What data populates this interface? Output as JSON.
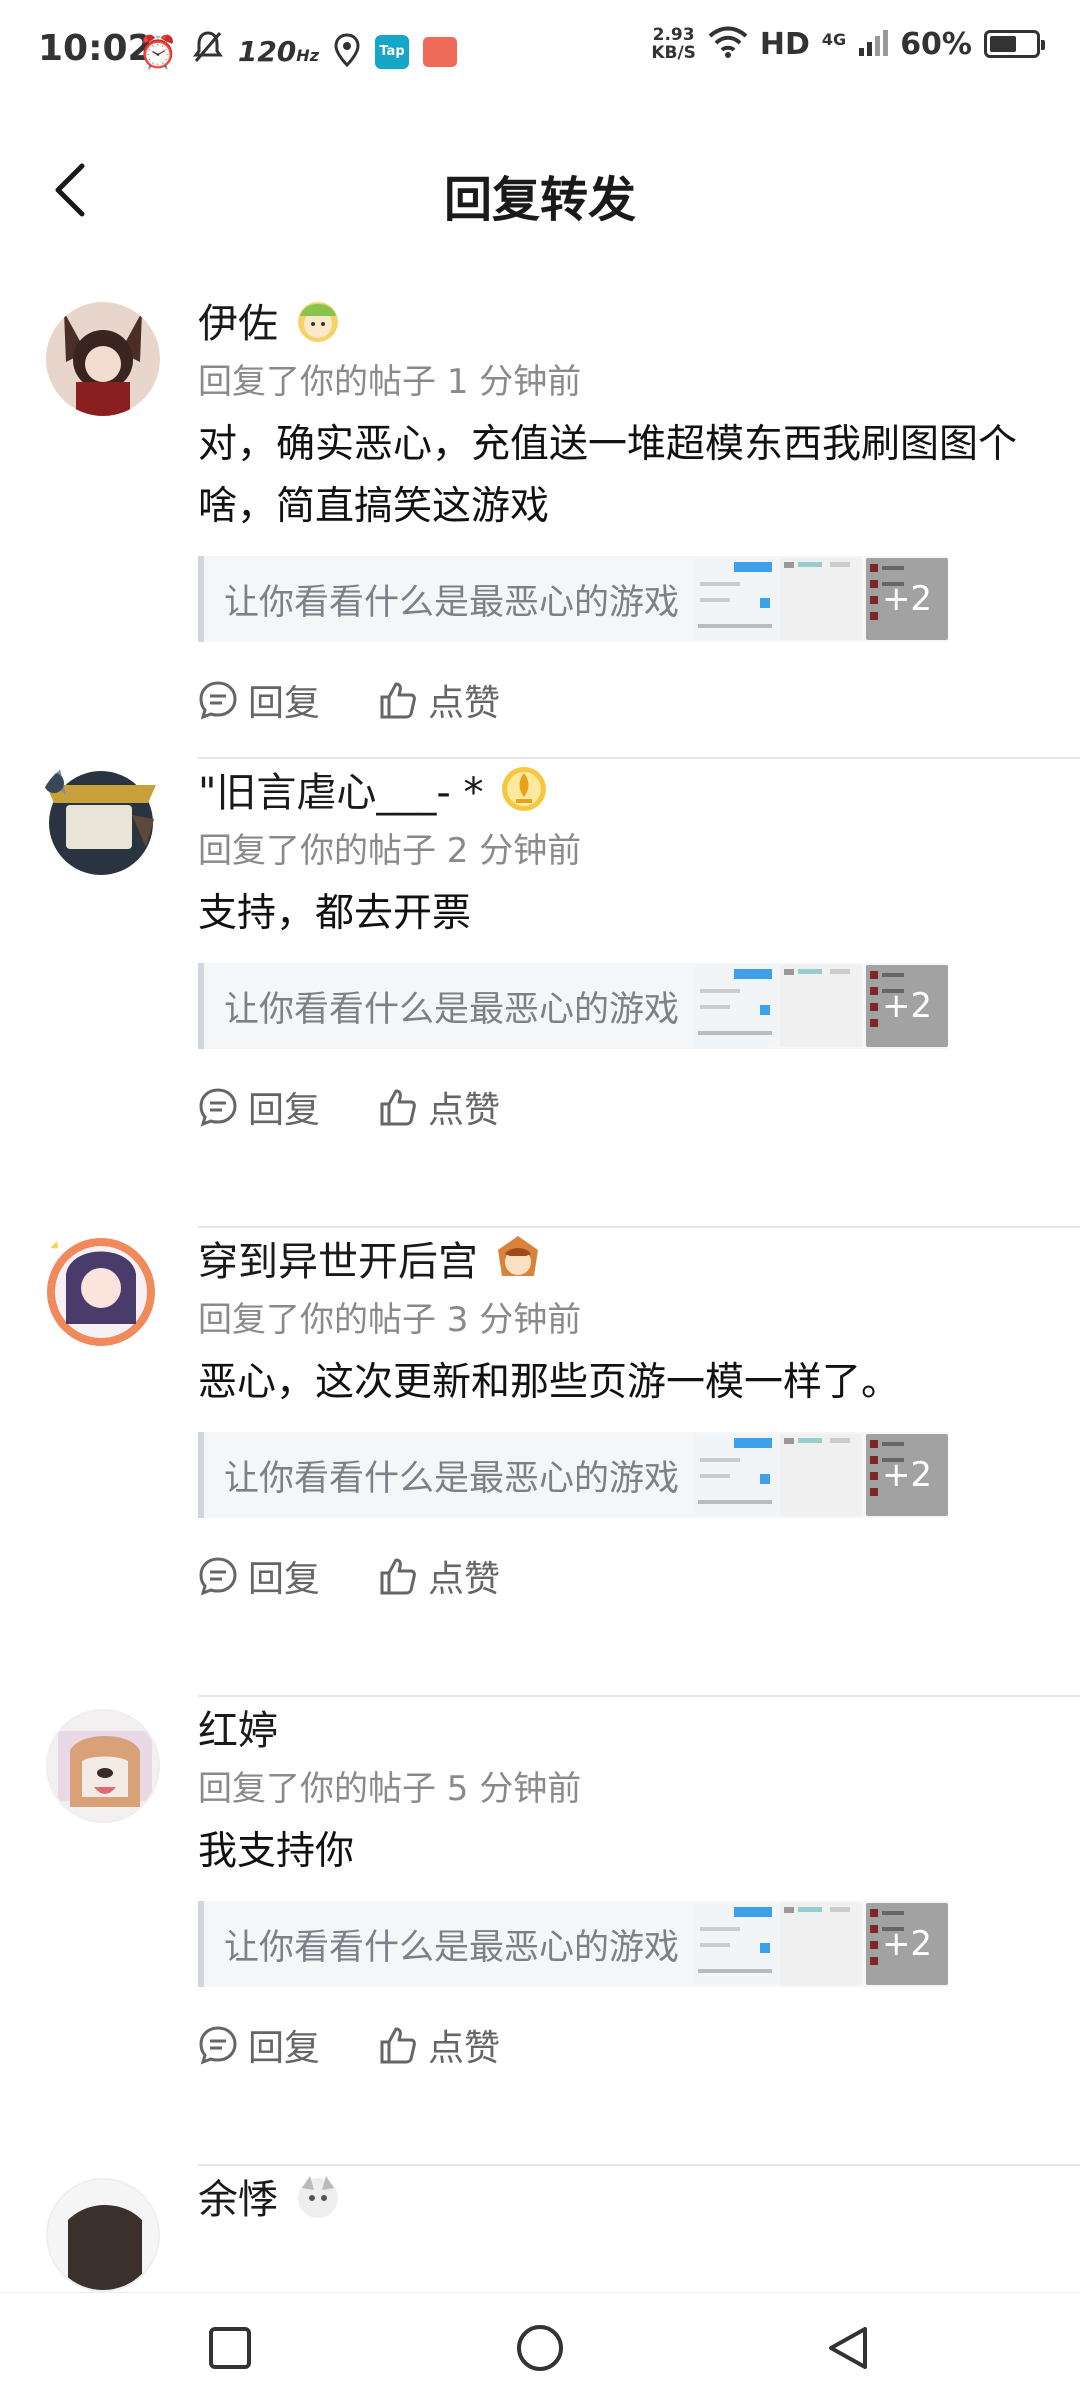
{
  "status_bar": {
    "time": "10:02",
    "refresh_rate": "120",
    "refresh_unit": "Hz",
    "tap_label": "Tap",
    "speed_value": "2.93",
    "speed_unit": "KB/S",
    "hd": "HD",
    "network": "4G",
    "battery": "60%",
    "battery_level": 0.6
  },
  "header": {
    "title": "回复转发"
  },
  "items": [
    {
      "name": "伊佐",
      "meta": "回复了你的帖子 1 分钟前",
      "text": "对，确实恶心，充值送一堆超模东西我刷图图个啥，简直搞笑这游戏",
      "quote": "让你看看什么是最恶心的游戏",
      "more": "+2",
      "reply": "回复",
      "like": "点赞"
    },
    {
      "name": "\"旧言虐心___- *",
      "meta": "回复了你的帖子 2 分钟前",
      "text": "支持，都去开票",
      "quote": "让你看看什么是最恶心的游戏",
      "more": "+2",
      "reply": "回复",
      "like": "点赞"
    },
    {
      "name": "穿到异世开后宫",
      "meta": "回复了你的帖子 3 分钟前",
      "text": "恶心，这次更新和那些页游一模一样了。",
      "quote": "让你看看什么是最恶心的游戏",
      "more": "+2",
      "reply": "回复",
      "like": "点赞"
    },
    {
      "name": "红婷",
      "meta": "回复了你的帖子 5 分钟前",
      "text": "我支持你",
      "quote": "让你看看什么是最恶心的游戏",
      "more": "+2",
      "reply": "回复",
      "like": "点赞"
    },
    {
      "name": "余悸"
    }
  ],
  "colors": {
    "accent_quote_border": "#cfd6dc",
    "meta_text": "#8a8a8a",
    "divider": "#e6e6e6"
  },
  "icons": [
    "back-arrow-icon",
    "comment-icon",
    "thumbs-up-icon",
    "home-square-icon",
    "home-circle-icon",
    "back-triangle-icon"
  ]
}
